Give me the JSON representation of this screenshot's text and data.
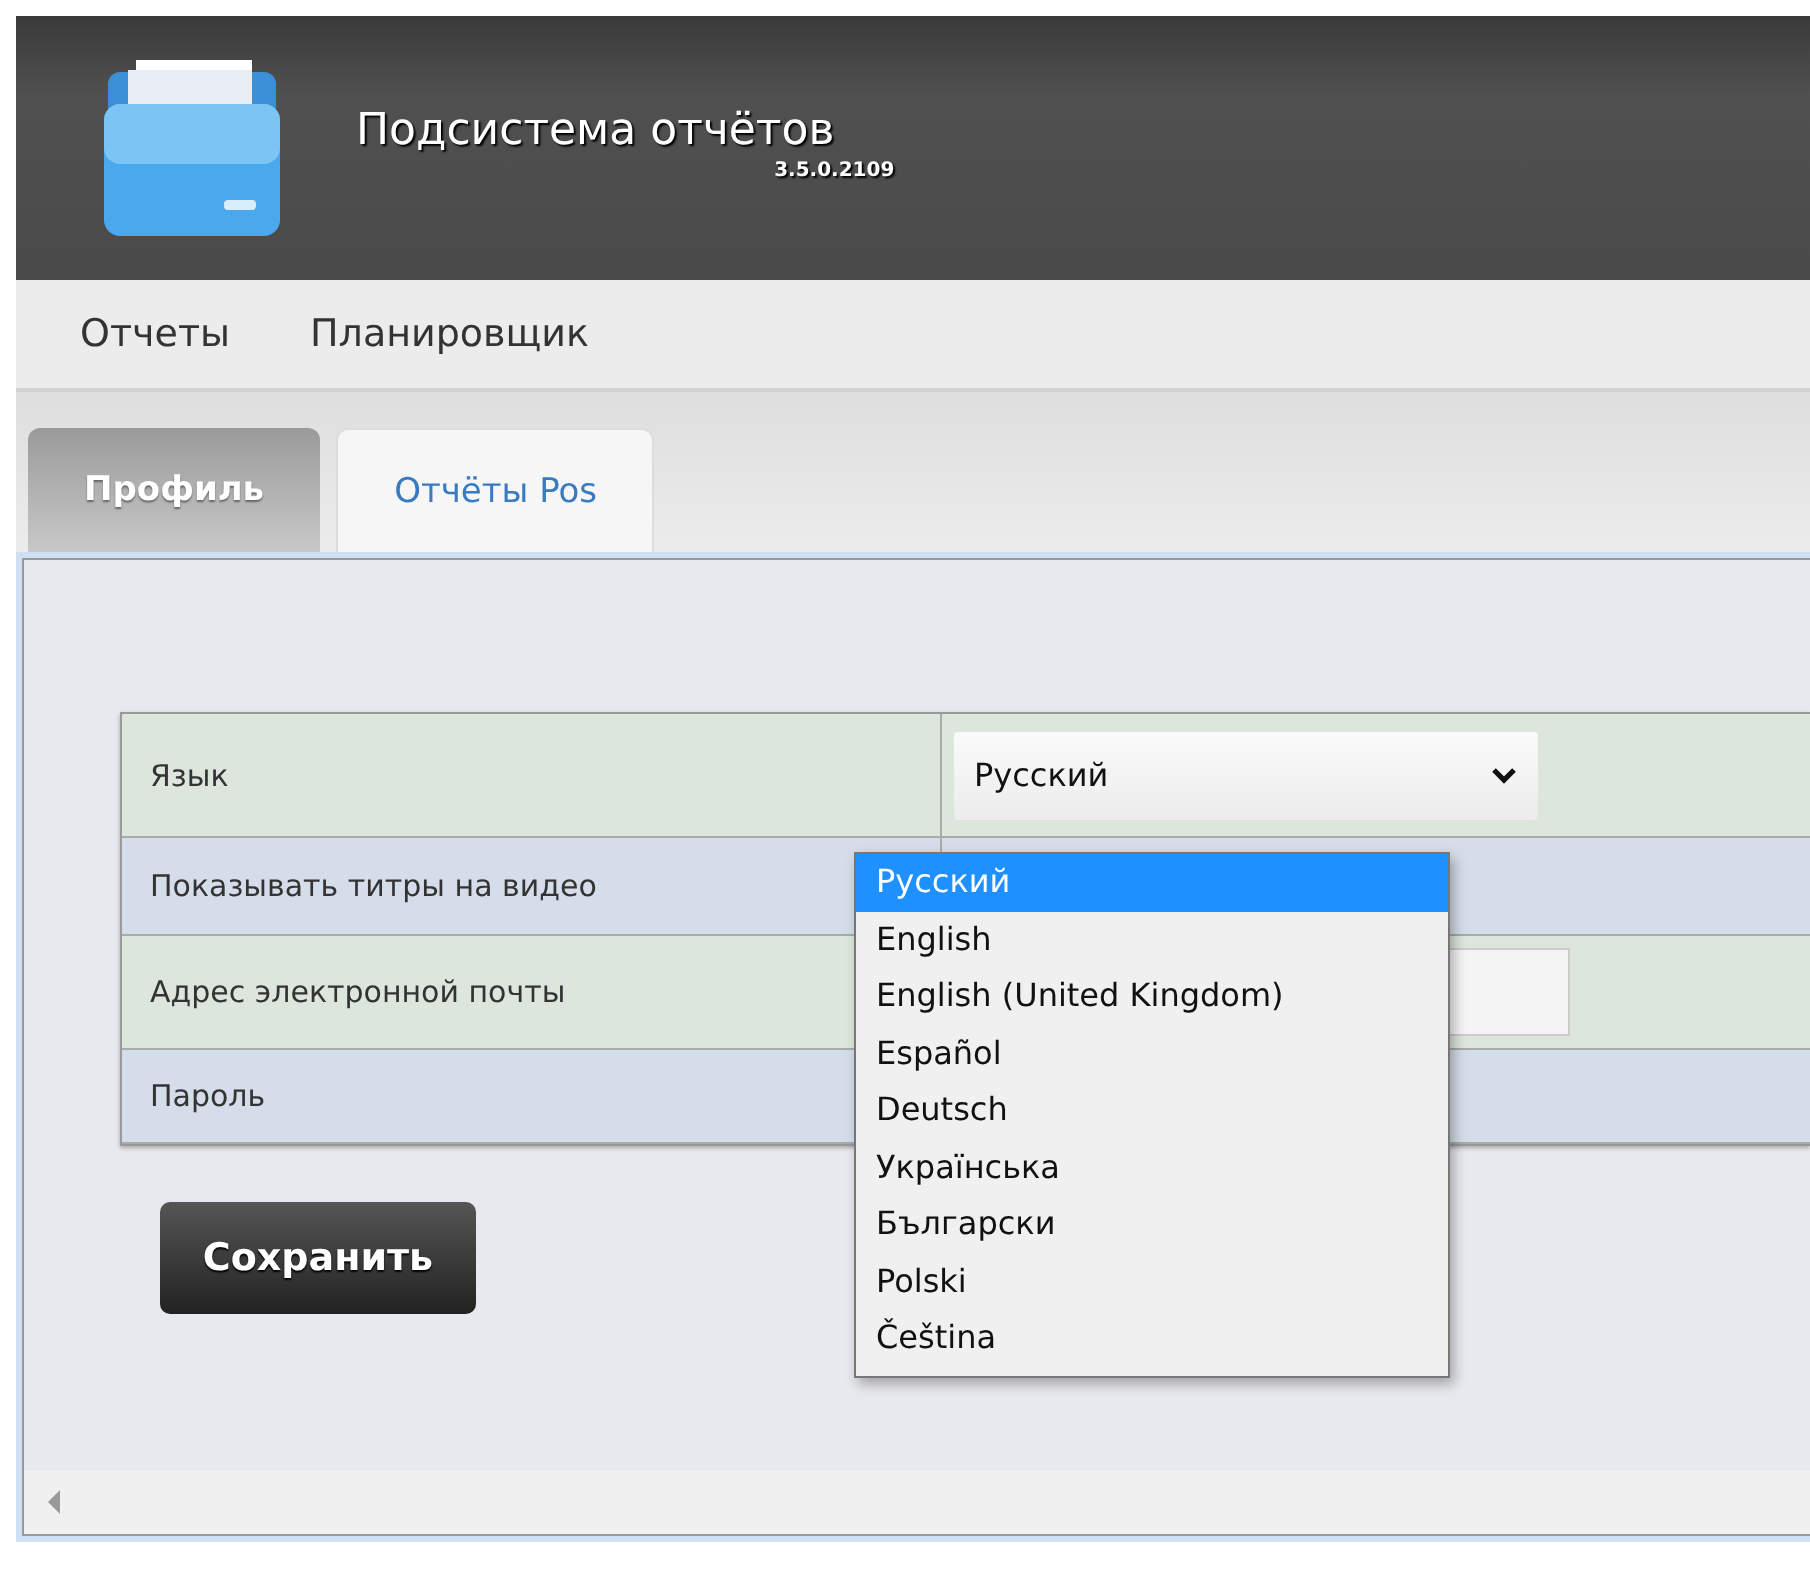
{
  "header": {
    "title": "Подсистема отчётов",
    "version": "3.5.0.2109"
  },
  "menu": [
    {
      "label": "Отчеты"
    },
    {
      "label": "Планировщик"
    }
  ],
  "tabs": [
    {
      "label": "Профиль",
      "selected": true
    },
    {
      "label": "Отчёты Pos",
      "selected": false
    }
  ],
  "form": {
    "rows": [
      {
        "label": "Язык",
        "kind": "select",
        "value": "Русский",
        "expanded": true
      },
      {
        "label": "Показывать титры на видео",
        "kind": "empty"
      },
      {
        "label": "Адрес электронной почты",
        "kind": "input"
      },
      {
        "label": "Пароль",
        "kind": "empty"
      }
    ],
    "options": [
      {
        "label": "Русский",
        "selected": true
      },
      {
        "label": "English",
        "selected": false
      },
      {
        "label": "English (United Kingdom)",
        "selected": false
      },
      {
        "label": "Español",
        "selected": false
      },
      {
        "label": "Deutsch",
        "selected": false
      },
      {
        "label": "Українська",
        "selected": false
      },
      {
        "label": "Български",
        "selected": false
      },
      {
        "label": "Polski",
        "selected": false
      },
      {
        "label": "Čeština",
        "selected": false
      }
    ]
  },
  "save_button": {
    "label": "Сохранить"
  }
}
